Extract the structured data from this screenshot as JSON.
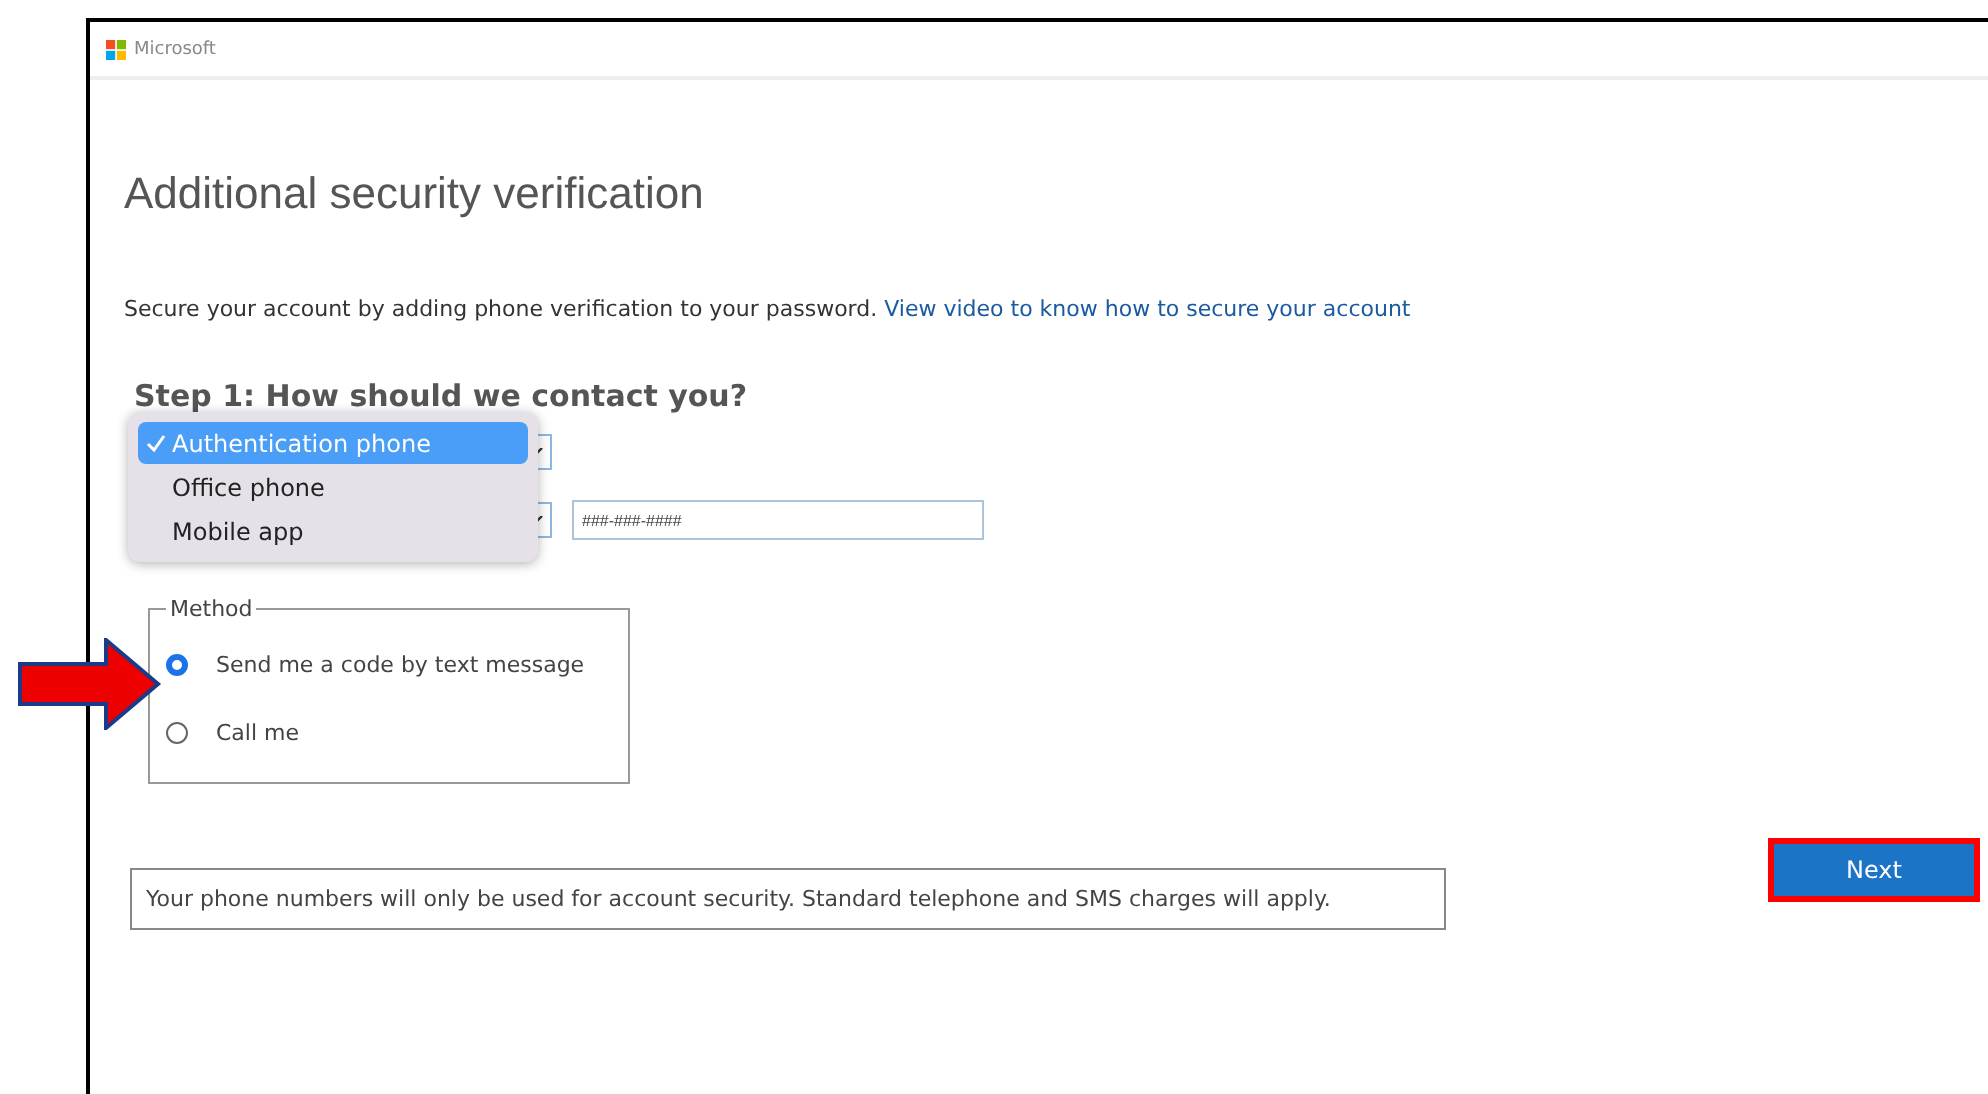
{
  "header": {
    "brand": "Microsoft"
  },
  "title": "Additional security verification",
  "intro": {
    "text": "Secure your account by adding phone verification to your password.",
    "link": "View video to know how to secure your account"
  },
  "step": {
    "heading": "Step 1: How should we contact you?"
  },
  "contact_dropdown": {
    "options": [
      {
        "label": "Authentication phone",
        "selected": true
      },
      {
        "label": "Office phone",
        "selected": false
      },
      {
        "label": "Mobile app",
        "selected": false
      }
    ]
  },
  "phone_field": {
    "placeholder": "###-###-####"
  },
  "method": {
    "legend": "Method",
    "options": [
      {
        "label": "Send me a code by text message",
        "selected": true
      },
      {
        "label": "Call me",
        "selected": false
      }
    ]
  },
  "annotation": {
    "arrow": true,
    "highlight_next": true
  },
  "next_button": "Next",
  "notice": "Your phone numbers will only be used for account security. Standard telephone and SMS charges will apply."
}
